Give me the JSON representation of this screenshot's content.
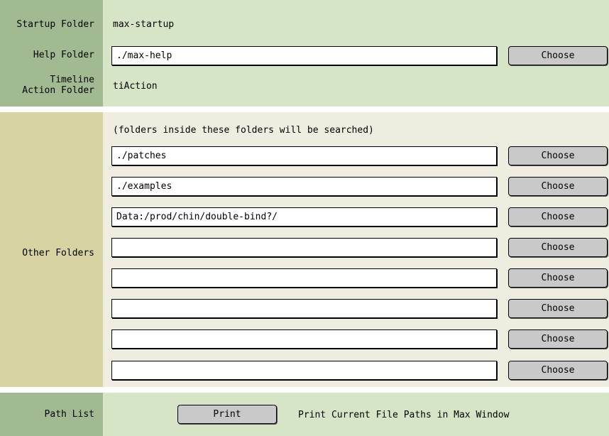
{
  "colors": {
    "label_column": "#a2ba92",
    "content_top": "#d5e5c6",
    "label_other": "#d7d3a2",
    "content_other": "#eeede0",
    "divider": "#ffffff"
  },
  "top": {
    "startup": {
      "label": "Startup Folder",
      "value": "max-startup"
    },
    "help": {
      "label": "Help Folder",
      "value": "./max-help",
      "button": "Choose"
    },
    "timeline": {
      "label_line1": "Timeline",
      "label_line2": "Action Folder",
      "value": "tiAction"
    }
  },
  "other": {
    "label": "Other Folders",
    "note": "(folders inside these folders will be searched)",
    "rows": [
      {
        "value": "./patches",
        "button": "Choose"
      },
      {
        "value": "./examples",
        "button": "Choose"
      },
      {
        "value": "Data:/prod/chin/double-bind?/",
        "button": "Choose"
      },
      {
        "value": "",
        "button": "Choose"
      },
      {
        "value": "",
        "button": "Choose"
      },
      {
        "value": "",
        "button": "Choose"
      },
      {
        "value": "",
        "button": "Choose"
      },
      {
        "value": "",
        "button": "Choose"
      }
    ]
  },
  "pathlist": {
    "label": "Path List",
    "button": "Print",
    "description": "Print Current File Paths in Max Window"
  }
}
